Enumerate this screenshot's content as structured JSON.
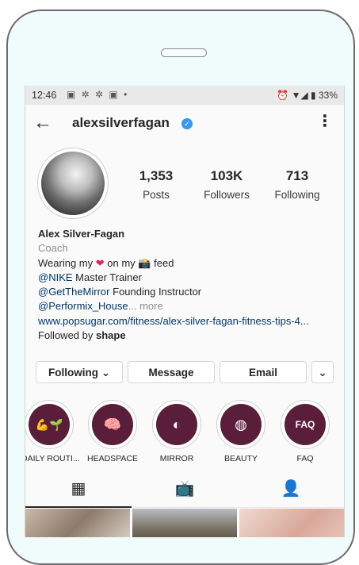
{
  "status_bar": {
    "time": "12:46",
    "notif_icons": "▣ ✲ ✲ ▣ •",
    "right": "⏰ ▼◢ ▮ 33%"
  },
  "header": {
    "username": "alexsilverfagan",
    "verified_icon": "verified-badge"
  },
  "profile": {
    "stats": [
      {
        "value": "1,353",
        "label": "Posts"
      },
      {
        "value": "103K",
        "label": "Followers"
      },
      {
        "value": "713",
        "label": "Following"
      }
    ],
    "bio": {
      "name": "Alex Silver-Fagan",
      "category": "Coach",
      "line1_pre": "Wearing my",
      "line1_mid": "on my",
      "line1_post": "feed",
      "line2_mention": "@NIKE",
      "line2_text": "Master Trainer",
      "line3_mention": "@GetTheMirror",
      "line3_text": "Founding Instructor",
      "line4_mention": "@Performix_House",
      "line4_more": "... more",
      "link": "www.popsugar.com/fitness/alex-silver-fagan-fitness-tips-4...",
      "followed_by_pre": "Followed by",
      "followed_by_name": "shape"
    }
  },
  "buttons": {
    "following": "Following ⌄",
    "message": "Message",
    "email": "Email",
    "dropdown": "⌄"
  },
  "highlights": [
    {
      "label": "DAILY ROUTI...",
      "icon": "💪🌱"
    },
    {
      "label": "HEADSPACE",
      "icon": "🧠"
    },
    {
      "label": "MIRROR",
      "icon": "◐"
    },
    {
      "label": "BEAUTY",
      "icon": "◍"
    },
    {
      "label": "FAQ",
      "icon": "FAQ"
    }
  ],
  "tabs": [
    {
      "name": "grid",
      "icon": "▦"
    },
    {
      "name": "igtv",
      "icon": "📺"
    },
    {
      "name": "tagged",
      "icon": "👤"
    }
  ],
  "colors": {
    "accent_link": "#00376b",
    "highlight_fill": "#5b1e3a",
    "verified_blue": "#3897f0"
  }
}
